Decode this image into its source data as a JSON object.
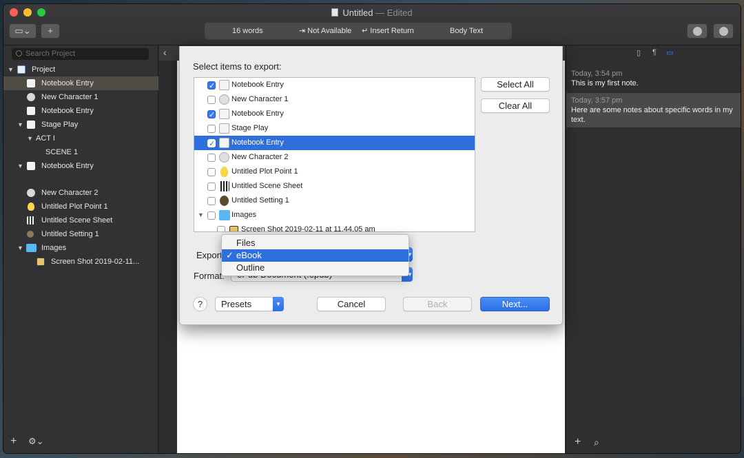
{
  "window": {
    "title": "Untitled",
    "title_suffix": "— Edited"
  },
  "toolbar": {
    "word_count": "16 words",
    "tab_action": "⇥ Not Available",
    "return_action": "↵ Insert Return",
    "style": "Body Text"
  },
  "binder": {
    "search_placeholder": "Search Project",
    "items": [
      {
        "label": "Project",
        "icon": "project-icon"
      },
      {
        "label": "Notebook Entry",
        "icon": "notebook-icon"
      },
      {
        "label": "New Character 1",
        "icon": "character-icon"
      },
      {
        "label": "Notebook Entry",
        "icon": "notebook-icon"
      },
      {
        "label": "Stage Play",
        "icon": "notebook-icon"
      },
      {
        "label": "ACT I",
        "icon": ""
      },
      {
        "label": "SCENE 1",
        "icon": ""
      },
      {
        "label": "Notebook Entry",
        "icon": "notebook-icon"
      },
      {
        "label": "New Character 2",
        "icon": "character-icon"
      },
      {
        "label": "Untitled Plot Point 1",
        "icon": "lightbulb-icon"
      },
      {
        "label": "Untitled Scene Sheet",
        "icon": "clapper-icon"
      },
      {
        "label": "Untitled Setting 1",
        "icon": "setting-icon"
      },
      {
        "label": "Images",
        "icon": "folder-icon"
      },
      {
        "label": "Screen Shot 2019-02-11...",
        "icon": "image-icon"
      }
    ]
  },
  "inspector": {
    "notes": [
      {
        "date": "Today, 3:54 pm",
        "text": "This is my first note."
      },
      {
        "date": "Today, 3:57 pm",
        "text": "Here are some notes about specific words in my text."
      }
    ]
  },
  "dialog": {
    "heading": "Select items to export:",
    "items": [
      {
        "label": "Notebook Entry",
        "checked": true
      },
      {
        "label": "New Character 1",
        "checked": false
      },
      {
        "label": "Notebook Entry",
        "checked": true
      },
      {
        "label": "Stage Play",
        "checked": false
      },
      {
        "label": "Notebook Entry",
        "checked": true
      },
      {
        "label": "New Character 2",
        "checked": false
      },
      {
        "label": "Untitled Plot Point 1",
        "checked": false
      },
      {
        "label": "Untitled Scene Sheet",
        "checked": false
      },
      {
        "label": "Untitled Setting 1",
        "checked": false
      },
      {
        "label": "Images",
        "checked": false
      },
      {
        "label": "Screen Shot 2019-02-11 at 11.44.05 am",
        "checked": false
      }
    ],
    "select_all": "Select All",
    "clear_all": "Clear All",
    "export_label": "Export",
    "format_label": "Format:",
    "format_value": "ePub Document (.epub)",
    "export_options": [
      "Files",
      "eBook",
      "Outline"
    ],
    "export_selected": "eBook",
    "help": "?",
    "presets": "Presets",
    "cancel": "Cancel",
    "back": "Back",
    "next": "Next..."
  },
  "colors": {
    "accent": "#2f6fdb",
    "window_bg": "#2c2c2e",
    "dialog_bg": "#ececec"
  }
}
